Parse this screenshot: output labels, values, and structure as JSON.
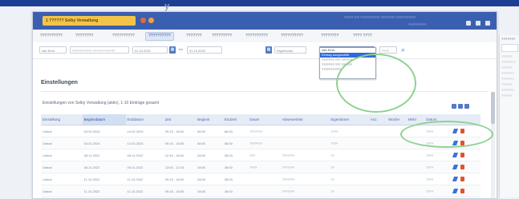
{
  "app": {
    "title_fragment": "y",
    "contact_badge": "1 ?????? Selby Verwaltung"
  },
  "header": {
    "right_text": "????? ??? ??????????? ???????? ???????????",
    "user_text": "??????????"
  },
  "tabs": [
    "??????????",
    "????????",
    "??????????",
    "??????????",
    "???????",
    "?????????",
    "??????????",
    "??????????",
    "????????",
    "???? ????"
  ],
  "filter": {
    "type_value": "Alle Eintr.",
    "range_value": "??????????? ?????? ??????",
    "date_from": "01.10.2022",
    "to_label": "bis",
    "date_to": "31.10.2022",
    "select_label": "Eigentümer",
    "select_value": "Alle Eintr.",
    "extra_value": "????"
  },
  "dropdown_options": [
    "Alle Eintr.",
    "Eintrag ausgewählt",
    "??????? ??? ??????",
    "??????? ??? ??????",
    "???????????"
  ],
  "section_title": "Einstellungen",
  "info_line": "Einstellungen von Selby Verwaltung (aktiv), 1-10 Einträge gesamt",
  "table": {
    "columns": [
      "Einstellung",
      "Beginndatum",
      "Enddatum",
      "Zeit",
      "Beginnt",
      "Endzeit",
      "Dauer",
      "Abwesenheit",
      "Eigentümer",
      "Anz.",
      "Woche",
      "Mehr",
      "Datum",
      ""
    ],
    "rows": [
      [
        "Urlaub",
        "03.02.2024",
        "14.02.2024",
        "09:15 - 18:00",
        "66:00",
        "66:00",
        "???????",
        "",
        "????",
        "",
        "",
        "",
        "????"
      ],
      [
        "Urlaub",
        "03.02.2024",
        "14.02.2024",
        "09:15 - 18:00",
        "66:00",
        "66:00",
        "???????",
        "",
        "????",
        "",
        "",
        "",
        "????"
      ],
      [
        "Urlaub",
        "08.11.2022",
        "08.11.2022",
        "12:45 - 18:00",
        "28:00",
        "28:00",
        "???",
        "???????",
        "??",
        "",
        "",
        "",
        "????"
      ],
      [
        "Urlaub",
        "08.11.2022",
        "08.11.2022",
        "13:00 - 12:15",
        "28:00",
        "28:00",
        "????",
        "???????",
        "??",
        "",
        "",
        "",
        "????"
      ],
      [
        "Urlaub",
        "11.10.2022",
        "11.10.2022",
        "09:15 - 18:00",
        "28:00",
        "28:00",
        "",
        "???????",
        "??",
        "",
        "",
        "",
        "????"
      ],
      [
        "Urlaub",
        "11.10.2022",
        "11.10.2022",
        "09:15 - 18:00",
        "28:00",
        "28:00",
        "",
        "???????",
        "??",
        "",
        "",
        "",
        "????"
      ]
    ]
  },
  "right_panel": {
    "heading": "???????",
    "items": [
      "??????",
      "????????",
      "??????",
      "???????",
      "???????",
      "??????",
      "???????",
      "??????"
    ]
  },
  "colors": {
    "header_blue": "#3b5fb0",
    "badge_yellow": "#f4c44a",
    "highlight_green": "#8ed18f",
    "select_blue": "#2f6bd8",
    "delete_red": "#e0532f"
  },
  "icons": {
    "calendar": "calendar-icon",
    "search": "search-icon",
    "edit": "edit-icon",
    "delete": "delete-icon"
  }
}
